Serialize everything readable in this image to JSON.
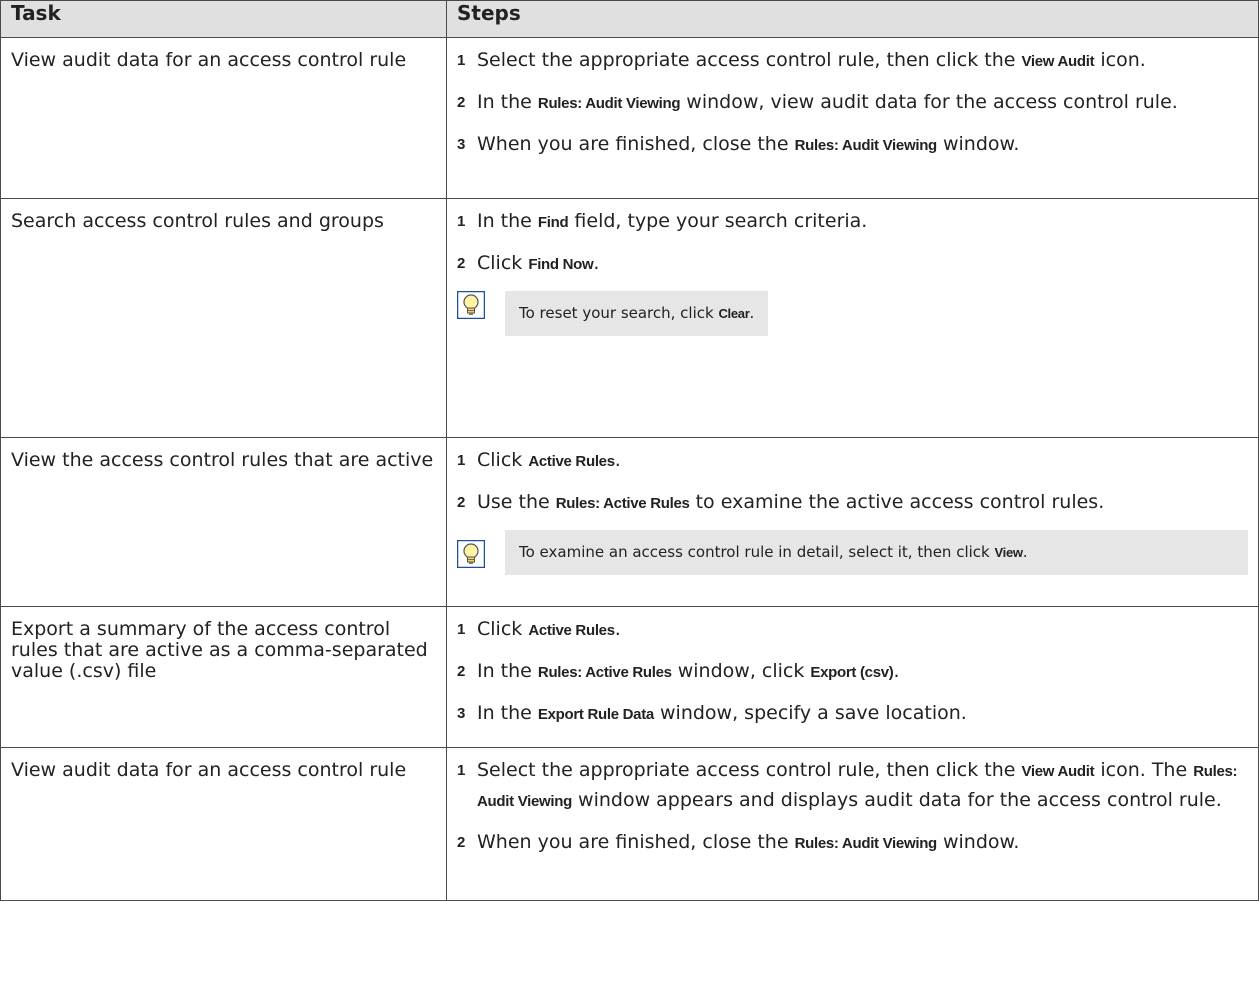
{
  "table": {
    "headers": {
      "task": "Task",
      "steps": "Steps"
    },
    "rows": [
      {
        "task": "View audit data for an access control rule",
        "steps": [
          {
            "n": "1",
            "parts": [
              "Select the appropriate access control rule, then click the ",
              "View Audit",
              " icon."
            ]
          },
          {
            "n": "2",
            "parts": [
              "In the ",
              "Rules: Audit Viewing",
              " window, view audit data for the access control rule."
            ]
          },
          {
            "n": "3",
            "parts": [
              "When you are finished, close the ",
              "Rules: Audit Viewing",
              " window."
            ]
          }
        ]
      },
      {
        "task": "Search access control rules and groups",
        "steps": [
          {
            "n": "1",
            "parts": [
              "In the ",
              "Find",
              " field, type your search criteria."
            ]
          },
          {
            "n": "2",
            "parts": [
              "Click ",
              "Find Now",
              "."
            ]
          }
        ],
        "note": {
          "icon": "lightbulb-icon",
          "parts": [
            "To reset your search, click ",
            "Clear",
            "."
          ]
        }
      },
      {
        "task": "View the access control rules that are active",
        "steps": [
          {
            "n": "1",
            "parts": [
              "Click ",
              "Active Rules",
              "."
            ]
          },
          {
            "n": "2",
            "parts": [
              "Use the ",
              "Rules: Active Rules",
              " to examine the active access control rules."
            ]
          }
        ],
        "note": {
          "icon": "lightbulb-icon",
          "parts": [
            "To examine an access control rule in detail, select it, then click ",
            "View",
            "."
          ]
        }
      },
      {
        "task": "Export a summary of the access control rules that are active as a comma-separated value (.csv) file",
        "steps": [
          {
            "n": "1",
            "parts": [
              "Click ",
              "Active Rules",
              "."
            ]
          },
          {
            "n": "2",
            "parts": [
              "In the ",
              "Rules: Active Rules",
              " window, click ",
              "Export (csv)",
              "."
            ]
          },
          {
            "n": "3",
            "parts": [
              "In the ",
              "Export Rule Data",
              " window, specify a save location."
            ]
          }
        ]
      },
      {
        "task": "View audit data for an access control rule",
        "steps": [
          {
            "n": "1",
            "parts": [
              "Select the appropriate access control rule, then click the ",
              "View Audit",
              " icon. The ",
              "Rules: Audit Viewing",
              " window appears and displays audit data for the access control rule."
            ]
          },
          {
            "n": "2",
            "parts": [
              "When you are finished, close the ",
              "Rules: Audit Viewing",
              " window."
            ]
          }
        ]
      }
    ]
  }
}
